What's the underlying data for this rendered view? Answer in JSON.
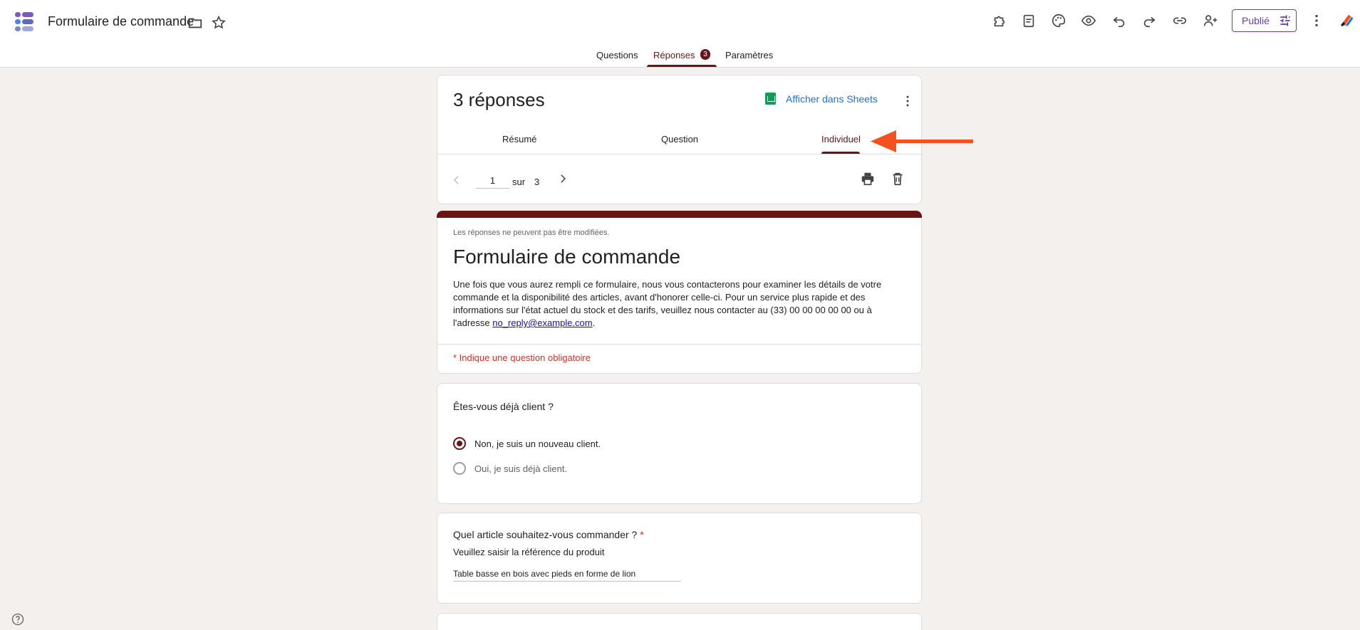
{
  "header": {
    "title": "Formulaire de commande",
    "publish_label": "Publié"
  },
  "tabs": [
    {
      "label": "Questions"
    },
    {
      "label": "Réponses",
      "badge": "3"
    },
    {
      "label": "Paramètres"
    }
  ],
  "responses": {
    "count_label": "3 réponses",
    "sheets_label": "Afficher dans Sheets",
    "sub_tabs": [
      "Résumé",
      "Question",
      "Individuel"
    ],
    "pager": {
      "current": "1",
      "sep": "sur",
      "total": "3"
    }
  },
  "form": {
    "note": "Les réponses ne peuvent pas être modifiées.",
    "title": "Formulaire de commande",
    "description": "Une fois que vous aurez rempli ce formulaire, nous vous contacterons pour examiner les détails de votre commande et la disponibilité des articles, avant d'honorer celle-ci. Pour un service plus rapide et des informations sur l'état actuel du stock et des tarifs, veuillez nous contacter au (33) 00 00 00 00 00 ou à l'adresse ",
    "email": "no_reply@example.com",
    "required_note": "* Indique une question obligatoire"
  },
  "q1": {
    "title": "Êtes-vous déjà client ?",
    "options": [
      "Non, je suis un nouveau client.",
      "Oui, je suis déjà client."
    ],
    "selected": 0
  },
  "q2": {
    "title": "Quel article souhaitez-vous commander ?",
    "required": "*",
    "help": "Veuillez saisir la référence du produit",
    "answer": "Table basse en bois avec pieds en forme de lion"
  },
  "colors": {
    "accent": "#6b1414",
    "arrow": "#f4511e"
  }
}
